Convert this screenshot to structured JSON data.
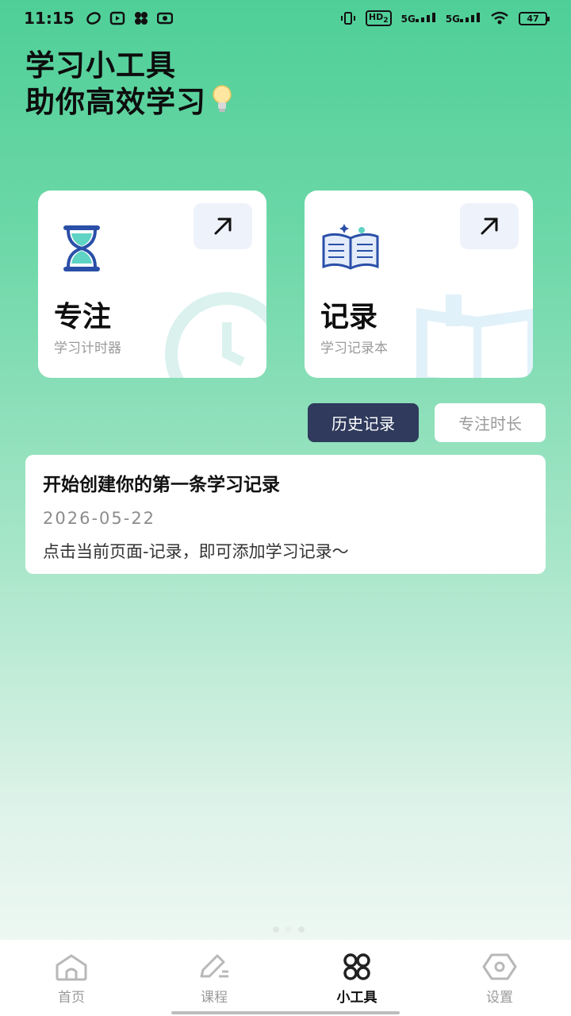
{
  "status_bar": {
    "time": "11:15",
    "network1": "5G",
    "network2": "5G",
    "hd": "HD",
    "hd_sub": "2",
    "battery": "47"
  },
  "header": {
    "line1": "学习小工具",
    "line2": "助你高效学习"
  },
  "cards": {
    "focus": {
      "title": "专注",
      "subtitle": "学习计时器"
    },
    "record": {
      "title": "记录",
      "subtitle": "学习记录本"
    }
  },
  "tabs": {
    "history": "历史记录",
    "duration": "专注时长"
  },
  "record_entry": {
    "title": "开始创建你的第一条学习记录",
    "date": "2026-05-22",
    "description": "点击当前页面-记录，即可添加学习记录～"
  },
  "bottom_nav": {
    "home": "首页",
    "courses": "课程",
    "tools": "小工具",
    "settings": "设置",
    "active": "tools"
  },
  "colors": {
    "accent_dark": "#2f3a5c",
    "icon_blue": "#2a4fa8",
    "icon_teal": "#5fd3c4"
  }
}
